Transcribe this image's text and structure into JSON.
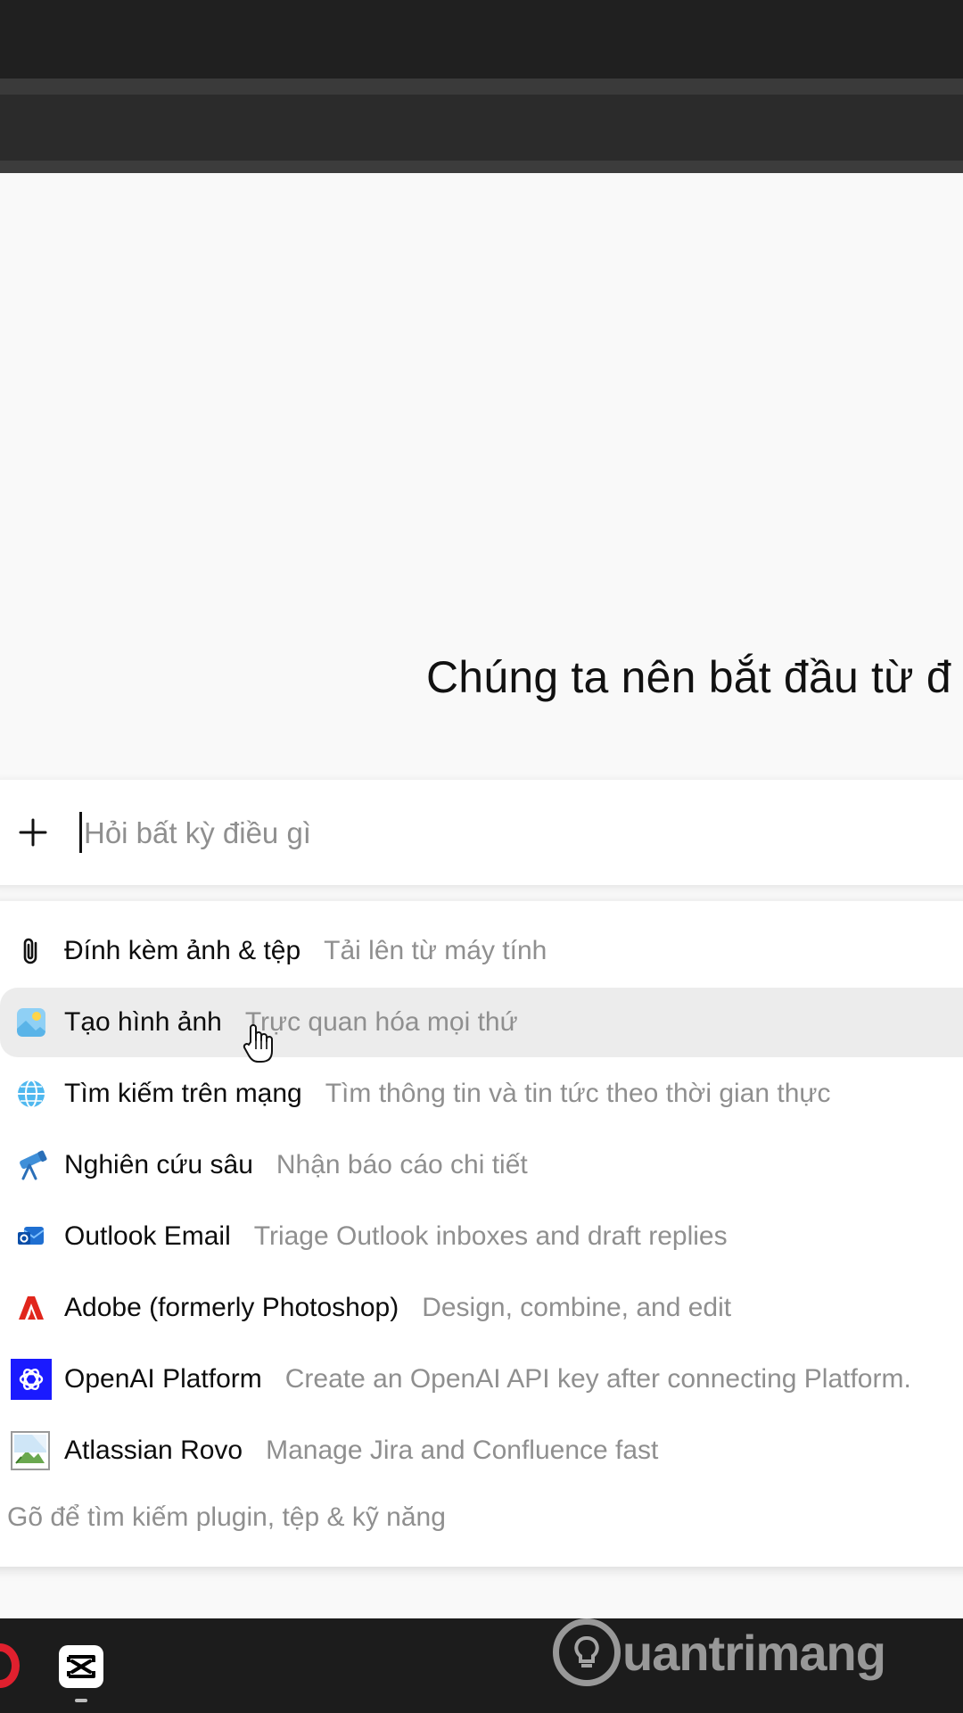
{
  "main": {
    "headline": "Chúng ta nên bắt đầu từ đ"
  },
  "composer": {
    "placeholder": "Hỏi bất kỳ điều gì",
    "plus_icon": "plus-icon"
  },
  "menu": {
    "items": [
      {
        "label": "Đính kèm ảnh & tệp",
        "desc": "Tải lên từ máy tính",
        "icon": "paperclip-icon"
      },
      {
        "label": "Tạo hình ảnh",
        "desc": "Trực quan hóa mọi thứ",
        "icon": "image-icon"
      },
      {
        "label": "Tìm kiếm trên mạng",
        "desc": "Tìm thông tin và tin tức theo thời gian thực",
        "icon": "globe-icon"
      },
      {
        "label": "Nghiên cứu sâu",
        "desc": "Nhận báo cáo chi tiết",
        "icon": "telescope-icon"
      },
      {
        "label": "Outlook Email",
        "desc": "Triage Outlook inboxes and draft replies",
        "icon": "outlook-icon"
      },
      {
        "label": "Adobe (formerly Photoshop)",
        "desc": "Design, combine, and edit",
        "icon": "adobe-icon"
      },
      {
        "label": "OpenAI Platform",
        "desc": "Create an OpenAI API key after connecting Platform.",
        "icon": "openai-icon"
      },
      {
        "label": "Atlassian Rovo",
        "desc": "Manage Jira and Confluence fast",
        "icon": "broken-image-icon"
      }
    ],
    "footer_hint": "Gõ để tìm kiếm plugin, tệp & kỹ năng"
  },
  "taskbar": {
    "apps": [
      "opera-icon",
      "capcut-icon"
    ]
  },
  "watermark": {
    "text": "uantrimang"
  },
  "colors": {
    "background": "#f9f9f9",
    "chrome": "#202020",
    "taskbar": "#1c1c1c",
    "muted_text": "#8f8f8f",
    "hover_row": "#ececec",
    "adobe_red": "#e1261c",
    "openai_blue": "#1a1aff"
  }
}
